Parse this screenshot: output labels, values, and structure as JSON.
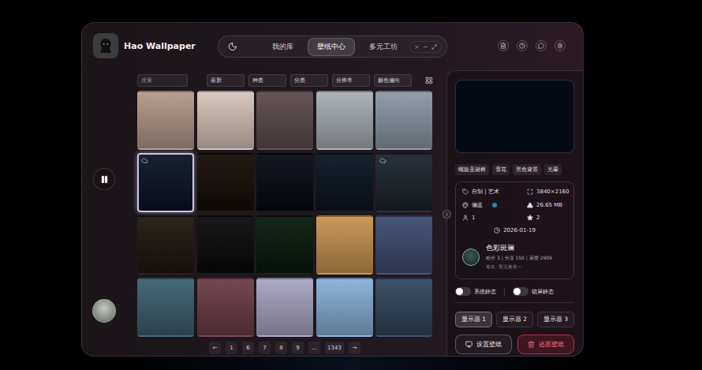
{
  "app": {
    "title": "Hao Wallpaper"
  },
  "nav": {
    "tabs": [
      {
        "label": "我的库",
        "selected": false
      },
      {
        "label": "壁纸中心",
        "selected": true
      },
      {
        "label": "多元工坊",
        "selected": false
      }
    ]
  },
  "player": {
    "playing": true
  },
  "filters": {
    "search_placeholder": "搜索",
    "dropdowns": [
      "最新",
      "种类",
      "分类",
      "分辨率",
      "颜色偏向"
    ]
  },
  "wallpapers": [
    {
      "selected": false,
      "animated": false,
      "color": "#b49888"
    },
    {
      "selected": false,
      "animated": false,
      "color": "#d8c4bc"
    },
    {
      "selected": false,
      "animated": false,
      "color": "#5c4c4c"
    },
    {
      "selected": false,
      "animated": false,
      "color": "#a8aeb4"
    },
    {
      "selected": false,
      "animated": false,
      "color": "#8c98a4"
    },
    {
      "selected": true,
      "animated": true,
      "color": "#0a1224"
    },
    {
      "selected": false,
      "animated": false,
      "color": "#140c06"
    },
    {
      "selected": false,
      "animated": false,
      "color": "#060912"
    },
    {
      "selected": false,
      "animated": false,
      "color": "#0a1420"
    },
    {
      "selected": false,
      "animated": true,
      "color": "#1c242c"
    },
    {
      "selected": false,
      "animated": false,
      "color": "#1e160e"
    },
    {
      "selected": false,
      "animated": false,
      "color": "#0a0a0c"
    },
    {
      "selected": false,
      "animated": false,
      "color": "#061a0c"
    },
    {
      "selected": false,
      "animated": false,
      "color": "#c89450"
    },
    {
      "selected": false,
      "animated": false,
      "color": "#3c4c70"
    },
    {
      "selected": false,
      "animated": false,
      "color": "#3c6070"
    },
    {
      "selected": false,
      "animated": false,
      "color": "#6c3c48"
    },
    {
      "selected": false,
      "animated": false,
      "color": "#a8a4c4"
    },
    {
      "selected": false,
      "animated": false,
      "color": "#88b0d8"
    },
    {
      "selected": false,
      "animated": false,
      "color": "#30465e"
    }
  ],
  "pagination": [
    {
      "label": "←",
      "selected": false
    },
    {
      "label": "1",
      "selected": false
    },
    {
      "label": "6",
      "selected": false
    },
    {
      "label": "7",
      "selected": false
    },
    {
      "label": "8",
      "selected": false
    },
    {
      "label": "9",
      "selected": false
    },
    {
      "label": "...",
      "selected": false
    },
    {
      "label": "1343",
      "selected": false
    },
    {
      "label": "→",
      "selected": false
    }
  ],
  "detail": {
    "preview_color": "#060a14",
    "tags": [
      "螺旋圣诞树",
      "雪花",
      "黑色背景",
      "光晕"
    ],
    "info": {
      "category": "自制 | 艺术",
      "resolution": "3840×2160",
      "color_tone": "偏蓝",
      "tone_color": "#2a86c0",
      "size": "26.65 MB",
      "downloads": "1",
      "favorites": "2",
      "date": "2026-01-19"
    },
    "author": {
      "name": "色彩斑斓",
      "stats": "粉丝 3 | 分享 150 | 获赞 2909",
      "signature": "签名: 暂无签名~"
    }
  },
  "toggles": [
    {
      "label": "系统静态",
      "on": false
    },
    {
      "label": "锁屏静态",
      "on": false
    }
  ],
  "monitors": [
    {
      "label": "显示器 1",
      "selected": true
    },
    {
      "label": "显示器 2",
      "selected": false
    },
    {
      "label": "显示器 3",
      "selected": false
    }
  ],
  "actions": {
    "set": "设置壁纸",
    "restore": "还原壁纸"
  }
}
